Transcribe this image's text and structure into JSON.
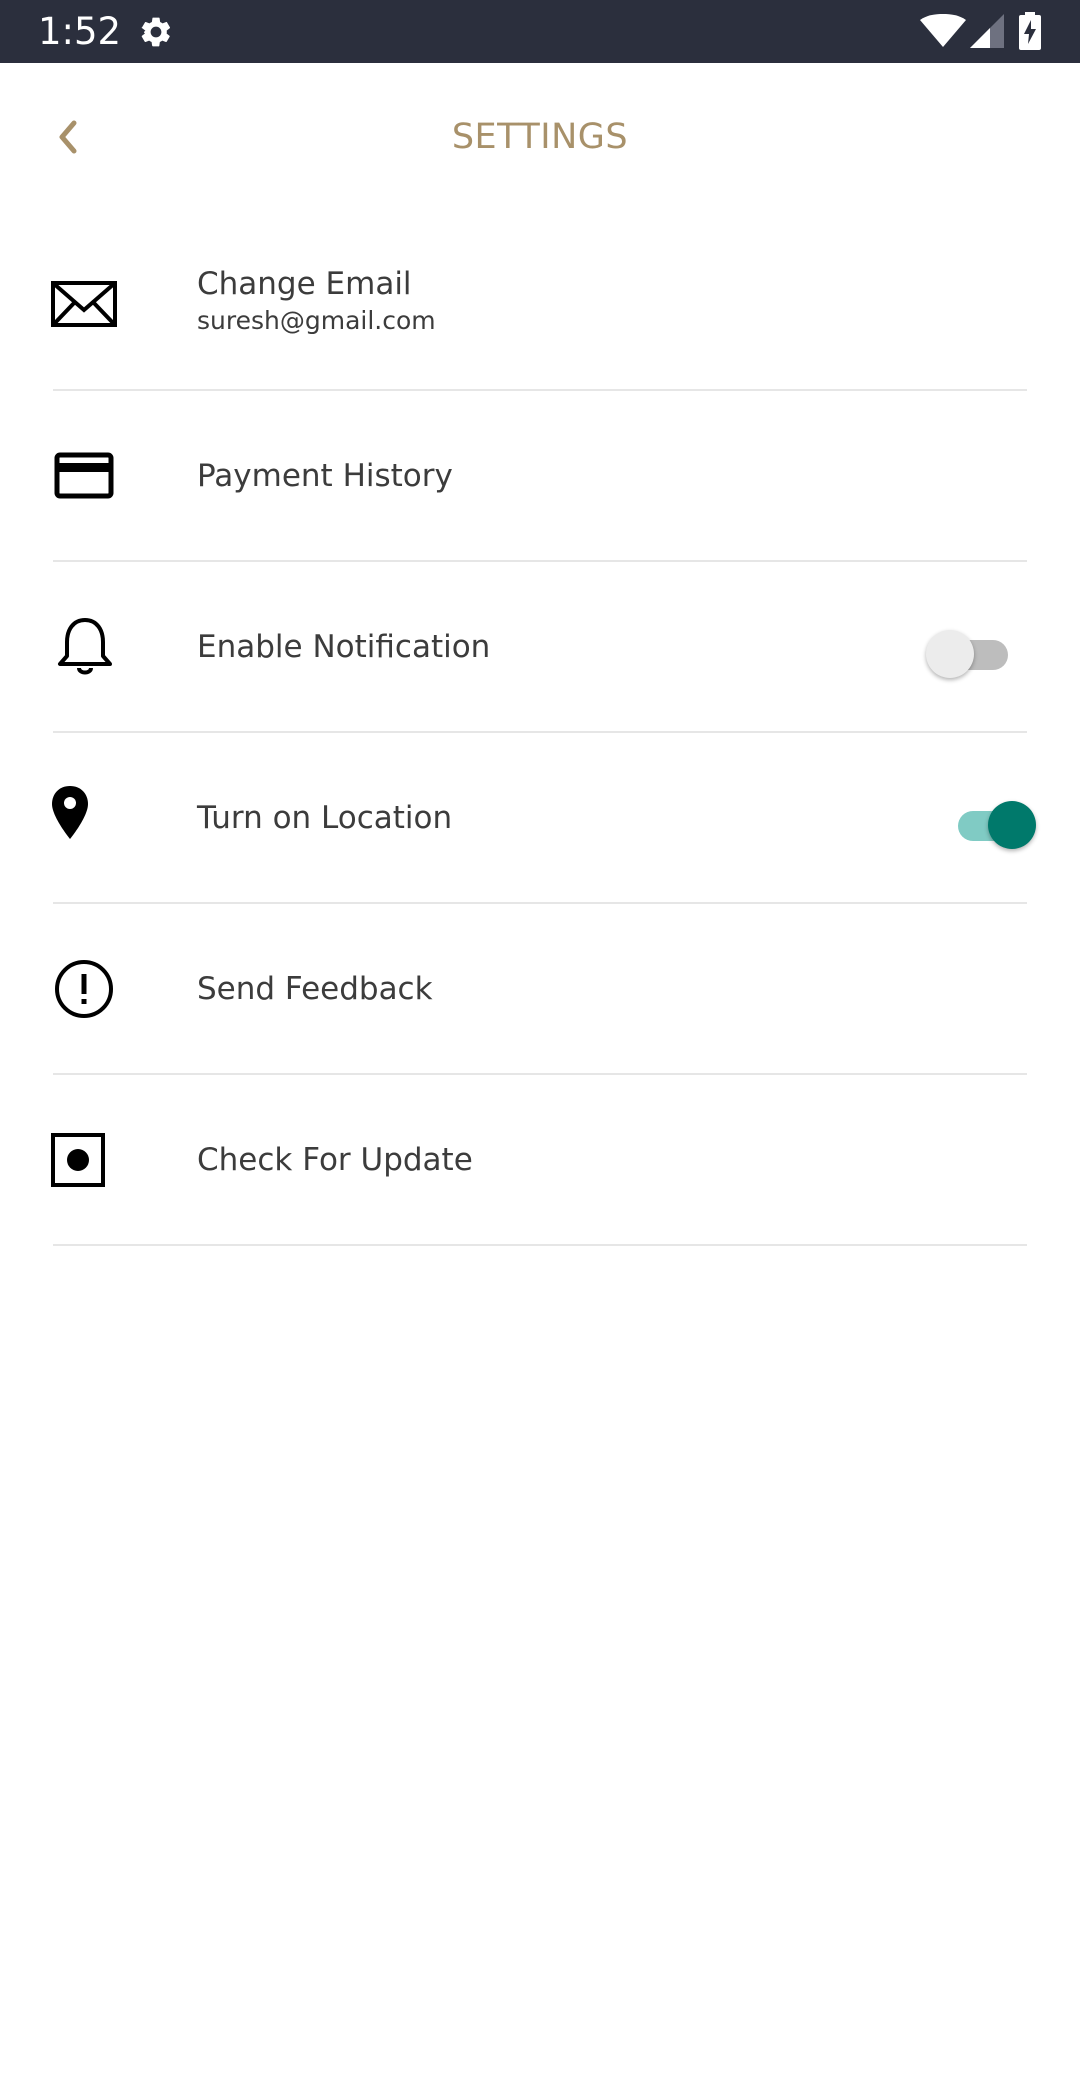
{
  "status_bar": {
    "time": "1:52",
    "icons": [
      "gear-icon",
      "wifi-icon",
      "signal-icon",
      "battery-charging-icon"
    ]
  },
  "header": {
    "title": "SETTINGS",
    "back_icon": "chevron-left-icon"
  },
  "colors": {
    "accent": "#a8916a",
    "status_bar": "#2b2f3d",
    "toggle_on_thumb": "#00796b",
    "toggle_on_track": "#80cbc4",
    "toggle_off_thumb": "#ececec",
    "toggle_off_track": "#bdbdbd",
    "text": "#3c3c3c",
    "divider": "#e6e6e6"
  },
  "settings": {
    "items": [
      {
        "label": "Change Email",
        "subtitle": "suresh@gmail.com",
        "icon": "envelope-icon"
      },
      {
        "label": "Payment History",
        "icon": "credit-card-icon"
      },
      {
        "label": "Enable Notification",
        "icon": "bell-icon",
        "toggle": false
      },
      {
        "label": "Turn on Location",
        "icon": "location-pin-icon",
        "toggle": true
      },
      {
        "label": "Send Feedback",
        "icon": "alert-circle-icon"
      },
      {
        "label": "Check For Update",
        "icon": "record-square-icon"
      }
    ]
  }
}
